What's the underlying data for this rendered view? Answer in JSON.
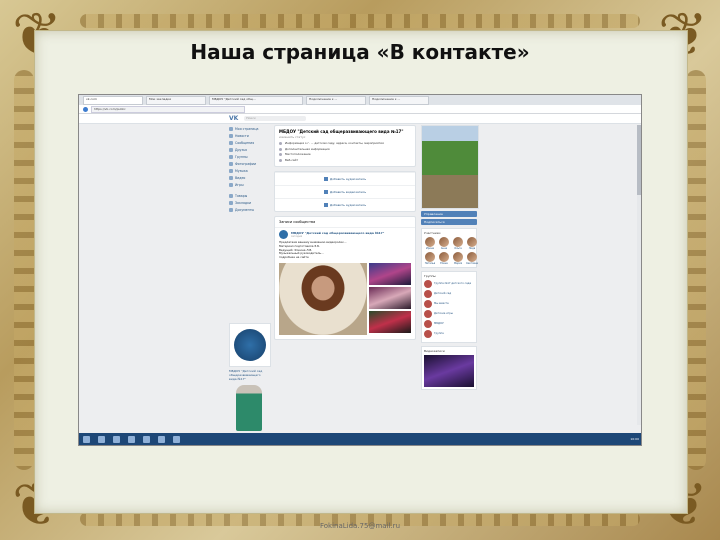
{
  "slide": {
    "title": "Наша страница «В контакте»",
    "footer": "FokinaLida.75@mail.ru"
  },
  "browser": {
    "tabs": [
      "vk.com",
      "Мои закладки",
      "МБДОУ \"Детский сад общ...",
      "Подключение к ...",
      "Подключение к ..."
    ],
    "url": "https://vk.com/public"
  },
  "vk": {
    "logo": "VK",
    "search_placeholder": "Поиск",
    "nav": [
      "Моя страница",
      "Новости",
      "Сообщения",
      "Друзья",
      "Группы",
      "Фотографии",
      "Музыка",
      "Видео",
      "Игры"
    ],
    "nav2": [
      "Товары",
      "Закладки",
      "Документы"
    ],
    "page_name": "МБДОУ \"Детский сад общеразвивающего вида №17\"",
    "page_status": "изменить статус",
    "info": [
      "Информация о г. ... детском саду, адреса, контакты, мероприятия",
      "Дополнительная информация",
      "Местоположение",
      "Веб-сайт"
    ],
    "actions": [
      "Добавить аудиозапись",
      "Добавить видеозапись",
      "Добавить аудиозапись"
    ],
    "wall_title": "Записи сообщества",
    "post_author": "МБДОУ \"Детский сад общеразвивающего вида №17\"",
    "post_date": "сегодня",
    "post_text": [
      "Предлагаем вашему вниманию видеоролик...",
      "Материал подготовила Э.Б.",
      "Ведущий: Фокина Л.В.",
      "Музыкальный руководитель...",
      "подробнее на сайте"
    ],
    "right_buttons": [
      "Управление",
      "Подписаться"
    ],
    "friends_title": "Участники",
    "friends": [
      "Ирина",
      "Анна",
      "Ольга",
      "Лида",
      "Наталья",
      "Елена",
      "Мария",
      "Светлана"
    ],
    "groups_title": "Группы",
    "groups": [
      "Группа №17 детского сада",
      "Детский сад",
      "Мы вместе",
      "Детские игры",
      "МБДОУ",
      "Группа"
    ],
    "video_title": "Видеозаписи",
    "ava_caption": "МБДОУ \"Детский сад общеразвивающего вида №17\"",
    "ad_caption": "Реклама",
    "clock": "10:00"
  }
}
